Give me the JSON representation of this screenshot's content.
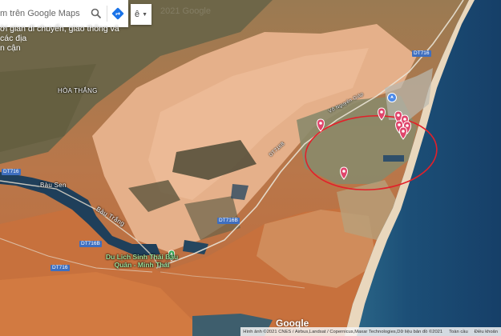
{
  "search": {
    "value": "m trên Google Maps",
    "suggestion_line1": "ời gian di chuyển, giao thông và các địa",
    "suggestion_line2": "n cận"
  },
  "side_toggle": {
    "label": "ê"
  },
  "watermark": "2021 Google",
  "places": {
    "hoa_thang": "HÒA THẮNG",
    "bau_sen": "Bàu Sen",
    "bau_trang": "Bàu Trắng"
  },
  "roads": {
    "dt716_top": "DT716",
    "dt716_left": "DT716",
    "dt716_bottom": "DT716",
    "dt716b_mid": "DT716B",
    "dt716b_left": "DT716B",
    "road_diag_label": "DT716B",
    "road_coast_label": "Võ Nguyên Giáp"
  },
  "poi": {
    "line1": "Du Lịch Sinh Thái Bàu",
    "line2": "Quân - Minh Thái"
  },
  "google_logo": "Google",
  "attribution": {
    "imagery": "Hình ảnh ©2021 CNES / Airbus,Landsat / Copernicus,Maxar Technologies,Dữ liệu bản đồ ©2021",
    "fullscreen": "Toàn cầu",
    "terms": "Điều khoản"
  },
  "colors": {
    "sand": "#e8b48c",
    "desert_orange": "#c7733f",
    "sea": "#1f4f78",
    "marker": "#e0456c",
    "highlight_circle": "#e3202a"
  },
  "markers_count": 8
}
